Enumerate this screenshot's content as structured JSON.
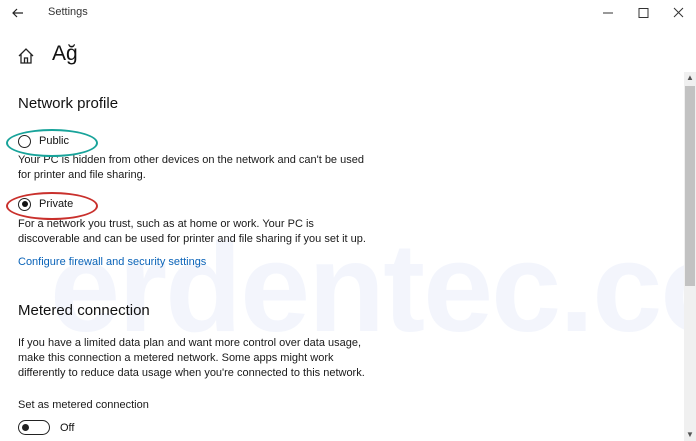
{
  "window": {
    "title": "Settings",
    "controls": {
      "minimize_icon": "minimize-icon",
      "maximize_icon": "maximize-icon",
      "close_icon": "close-icon"
    }
  },
  "header": {
    "title": "Ağ",
    "home_icon": "home-icon",
    "back_icon": "back-arrow-icon"
  },
  "network_profile": {
    "title": "Network profile",
    "options": [
      {
        "label": "Public",
        "selected": false,
        "description": "Your PC is hidden from other devices on the network and can't be used for printer and file sharing."
      },
      {
        "label": "Private",
        "selected": true,
        "description": "For a network you trust, such as at home or work. Your PC is discoverable and can be used for printer and file sharing if you set it up."
      }
    ],
    "link": "Configure firewall and security settings"
  },
  "metered": {
    "title": "Metered connection",
    "description": "If you have a limited data plan and want more control over data usage, make this connection a metered network. Some apps might work differently to reduce data usage when you're connected to this network.",
    "toggle_label": "Set as metered connection",
    "toggle_state": "Off",
    "toggle_on": false
  },
  "watermark": "erdentec.com",
  "colors": {
    "accent_link": "#0a63b8",
    "highlight_public": "#18a39a",
    "highlight_private": "#c9302c"
  }
}
